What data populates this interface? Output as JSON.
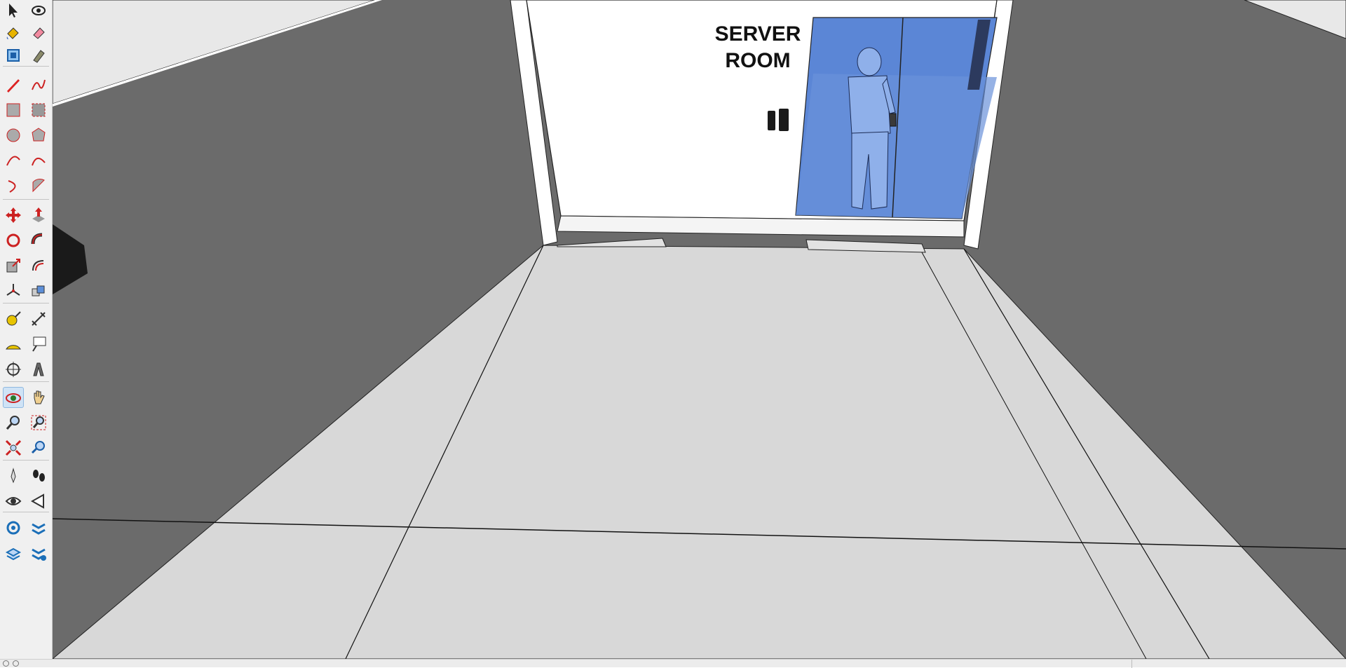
{
  "app": {
    "accent": "#cfe3f6"
  },
  "scene": {
    "sign_line1": "SERVER",
    "sign_line2": "ROOM",
    "colors": {
      "walls": "#6b6b6b",
      "floor": "#d8d8d8",
      "doorway_wall": "#ffffff",
      "glass": "#5b86d6",
      "ceiling": "#e8e8e8"
    }
  },
  "toolbar": {
    "tools": [
      {
        "name": "select-tool-icon",
        "active": false
      },
      {
        "name": "orbit-lasso-tool-icon",
        "active": false
      },
      {
        "name": "paint-bucket-tool-icon",
        "active": false
      },
      {
        "name": "eraser-tool-icon",
        "active": false
      },
      {
        "name": "components-tool-icon",
        "active": false
      },
      {
        "name": "tag-tool-icon",
        "active": false
      },
      {
        "name": "pencil-line-tool-icon",
        "active": false
      },
      {
        "name": "freehand-tool-icon",
        "active": false
      },
      {
        "name": "rectangle-tool-icon",
        "active": false
      },
      {
        "name": "rotated-rectangle-tool-icon",
        "active": false
      },
      {
        "name": "circle-tool-icon",
        "active": false
      },
      {
        "name": "polygon-tool-icon",
        "active": false
      },
      {
        "name": "arc-tool-icon",
        "active": false
      },
      {
        "name": "two-point-arc-tool-icon",
        "active": false
      },
      {
        "name": "three-point-arc-tool-icon",
        "active": false
      },
      {
        "name": "pie-tool-icon",
        "active": false
      },
      {
        "name": "move-tool-icon",
        "active": false
      },
      {
        "name": "push-pull-tool-icon",
        "active": false
      },
      {
        "name": "rotate-tool-icon",
        "active": false
      },
      {
        "name": "follow-me-tool-icon",
        "active": false
      },
      {
        "name": "scale-tool-icon",
        "active": false
      },
      {
        "name": "offset-tool-icon",
        "active": false
      },
      {
        "name": "axes-tool-icon",
        "active": false
      },
      {
        "name": "solid-tools-icon",
        "active": false
      },
      {
        "name": "tape-measure-tool-icon",
        "active": false
      },
      {
        "name": "dimension-tool-icon",
        "active": false
      },
      {
        "name": "protractor-tool-icon",
        "active": false
      },
      {
        "name": "text-tool-icon",
        "active": false
      },
      {
        "name": "axes-position-tool-icon",
        "active": false
      },
      {
        "name": "3d-text-tool-icon",
        "active": false
      },
      {
        "name": "orbit-tool-icon",
        "active": true
      },
      {
        "name": "pan-tool-icon",
        "active": false
      },
      {
        "name": "zoom-tool-icon",
        "active": false
      },
      {
        "name": "zoom-window-tool-icon",
        "active": false
      },
      {
        "name": "zoom-extents-tool-icon",
        "active": false
      },
      {
        "name": "previous-view-tool-icon",
        "active": false
      },
      {
        "name": "position-camera-tool-icon",
        "active": false
      },
      {
        "name": "walk-tool-icon",
        "active": false
      },
      {
        "name": "look-around-tool-icon",
        "active": false
      },
      {
        "name": "section-plane-tool-icon",
        "active": false
      },
      {
        "name": "warehouse-tool-icon",
        "active": false
      },
      {
        "name": "extension-warehouse-tool-icon",
        "active": false
      },
      {
        "name": "layout-tool-icon",
        "active": false
      },
      {
        "name": "extension-manager-tool-icon",
        "active": false
      }
    ]
  },
  "statusbar": {
    "hint": "",
    "measurements_label": ""
  }
}
